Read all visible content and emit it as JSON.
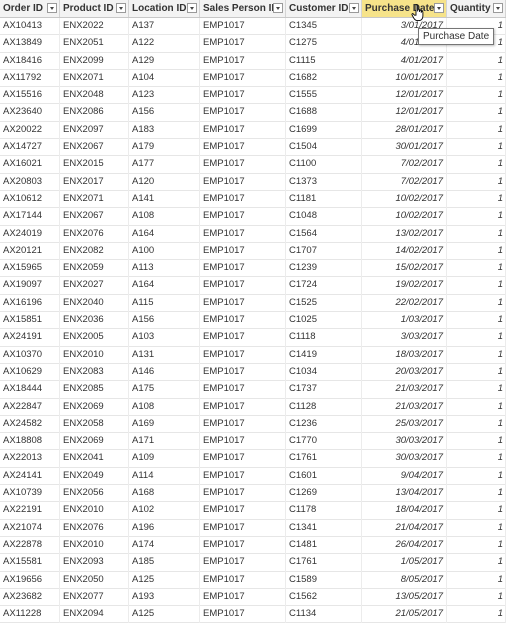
{
  "table": {
    "columns": [
      {
        "label": "Order ID",
        "key": "order_id"
      },
      {
        "label": "Product ID",
        "key": "product_id"
      },
      {
        "label": "Location ID",
        "key": "location_id"
      },
      {
        "label": "Sales Person ID",
        "key": "sales_person_id"
      },
      {
        "label": "Customer ID",
        "key": "customer_id"
      },
      {
        "label": "Purchase Date",
        "key": "purchase_date"
      },
      {
        "label": "Quantity",
        "key": "quantity"
      }
    ],
    "active_column": "Purchase Date",
    "rows": [
      [
        "AX10413",
        "ENX2022",
        "A137",
        "EMP1017",
        "C1345",
        "3/01/2017",
        "1"
      ],
      [
        "AX13849",
        "ENX2051",
        "A122",
        "EMP1017",
        "C1275",
        "4/01/2017",
        "1"
      ],
      [
        "AX18416",
        "ENX2099",
        "A129",
        "EMP1017",
        "C1115",
        "4/01/2017",
        "1"
      ],
      [
        "AX11792",
        "ENX2071",
        "A104",
        "EMP1017",
        "C1682",
        "10/01/2017",
        "1"
      ],
      [
        "AX15516",
        "ENX2048",
        "A123",
        "EMP1017",
        "C1555",
        "12/01/2017",
        "1"
      ],
      [
        "AX23640",
        "ENX2086",
        "A156",
        "EMP1017",
        "C1688",
        "12/01/2017",
        "1"
      ],
      [
        "AX20022",
        "ENX2097",
        "A183",
        "EMP1017",
        "C1699",
        "28/01/2017",
        "1"
      ],
      [
        "AX14727",
        "ENX2067",
        "A179",
        "EMP1017",
        "C1504",
        "30/01/2017",
        "1"
      ],
      [
        "AX16021",
        "ENX2015",
        "A177",
        "EMP1017",
        "C1100",
        "7/02/2017",
        "1"
      ],
      [
        "AX20803",
        "ENX2017",
        "A120",
        "EMP1017",
        "C1373",
        "7/02/2017",
        "1"
      ],
      [
        "AX10612",
        "ENX2071",
        "A141",
        "EMP1017",
        "C1181",
        "10/02/2017",
        "1"
      ],
      [
        "AX17144",
        "ENX2067",
        "A108",
        "EMP1017",
        "C1048",
        "10/02/2017",
        "1"
      ],
      [
        "AX24019",
        "ENX2076",
        "A164",
        "EMP1017",
        "C1564",
        "13/02/2017",
        "1"
      ],
      [
        "AX20121",
        "ENX2082",
        "A100",
        "EMP1017",
        "C1707",
        "14/02/2017",
        "1"
      ],
      [
        "AX15965",
        "ENX2059",
        "A113",
        "EMP1017",
        "C1239",
        "15/02/2017",
        "1"
      ],
      [
        "AX19097",
        "ENX2027",
        "A164",
        "EMP1017",
        "C1724",
        "19/02/2017",
        "1"
      ],
      [
        "AX16196",
        "ENX2040",
        "A115",
        "EMP1017",
        "C1525",
        "22/02/2017",
        "1"
      ],
      [
        "AX15851",
        "ENX2036",
        "A156",
        "EMP1017",
        "C1025",
        "1/03/2017",
        "1"
      ],
      [
        "AX24191",
        "ENX2005",
        "A103",
        "EMP1017",
        "C1118",
        "3/03/2017",
        "1"
      ],
      [
        "AX10370",
        "ENX2010",
        "A131",
        "EMP1017",
        "C1419",
        "18/03/2017",
        "1"
      ],
      [
        "AX10629",
        "ENX2083",
        "A146",
        "EMP1017",
        "C1034",
        "20/03/2017",
        "1"
      ],
      [
        "AX18444",
        "ENX2085",
        "A175",
        "EMP1017",
        "C1737",
        "21/03/2017",
        "1"
      ],
      [
        "AX22847",
        "ENX2069",
        "A108",
        "EMP1017",
        "C1128",
        "21/03/2017",
        "1"
      ],
      [
        "AX24582",
        "ENX2058",
        "A169",
        "EMP1017",
        "C1236",
        "25/03/2017",
        "1"
      ],
      [
        "AX18808",
        "ENX2069",
        "A171",
        "EMP1017",
        "C1770",
        "30/03/2017",
        "1"
      ],
      [
        "AX22013",
        "ENX2041",
        "A109",
        "EMP1017",
        "C1761",
        "30/03/2017",
        "1"
      ],
      [
        "AX24141",
        "ENX2049",
        "A114",
        "EMP1017",
        "C1601",
        "9/04/2017",
        "1"
      ],
      [
        "AX10739",
        "ENX2056",
        "A168",
        "EMP1017",
        "C1269",
        "13/04/2017",
        "1"
      ],
      [
        "AX22191",
        "ENX2010",
        "A102",
        "EMP1017",
        "C1178",
        "18/04/2017",
        "1"
      ],
      [
        "AX21074",
        "ENX2076",
        "A196",
        "EMP1017",
        "C1341",
        "21/04/2017",
        "1"
      ],
      [
        "AX22878",
        "ENX2010",
        "A174",
        "EMP1017",
        "C1481",
        "26/04/2017",
        "1"
      ],
      [
        "AX15581",
        "ENX2093",
        "A185",
        "EMP1017",
        "C1761",
        "1/05/2017",
        "1"
      ],
      [
        "AX19656",
        "ENX2050",
        "A125",
        "EMP1017",
        "C1589",
        "8/05/2017",
        "1"
      ],
      [
        "AX23682",
        "ENX2077",
        "A193",
        "EMP1017",
        "C1562",
        "13/05/2017",
        "1"
      ],
      [
        "AX11228",
        "ENX2094",
        "A125",
        "EMP1017",
        "C1134",
        "21/05/2017",
        "1"
      ]
    ]
  },
  "tooltip": {
    "text": "Purchase Date"
  },
  "icons": {
    "dropdown": "chevron-down-icon",
    "cursor": "hand-pointer-icon"
  },
  "colors": {
    "active_header": "#f6e38a",
    "header_bg": "#f3f3f3"
  }
}
